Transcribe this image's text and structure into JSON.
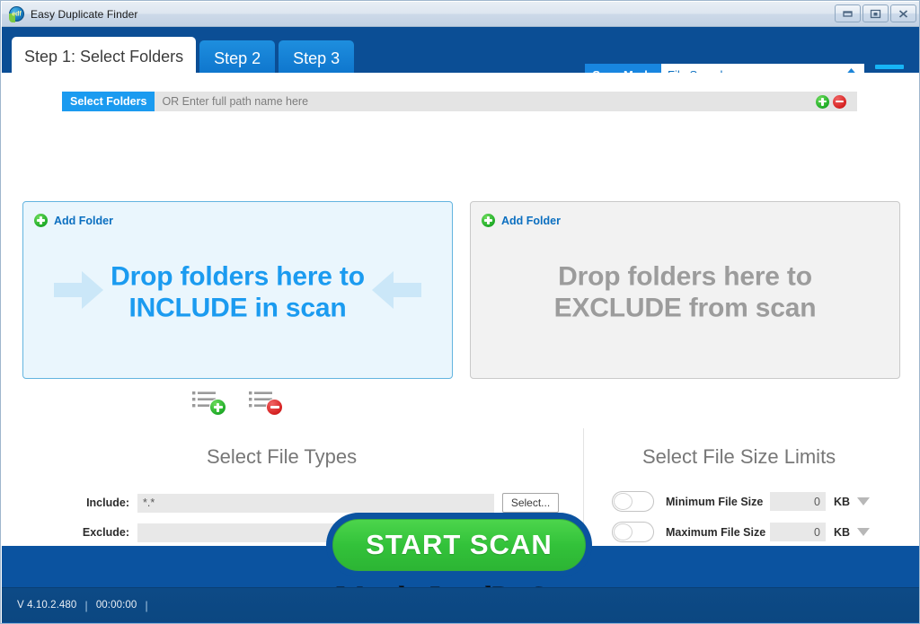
{
  "window": {
    "title": "Easy Duplicate Finder",
    "app_icon": "edf-logo-icon",
    "controls": {
      "minimize": "minimize-icon",
      "restore": "restore-icon",
      "close": "close-icon"
    }
  },
  "tabs": [
    {
      "label": "Step 1: Select Folders",
      "active": true
    },
    {
      "label": "Step 2",
      "active": false
    },
    {
      "label": "Step 3",
      "active": false
    }
  ],
  "scan_mode": {
    "label": "Scan Mode",
    "value": "File Search",
    "options": [
      "File Search"
    ]
  },
  "menu": {
    "icon": "hamburger-menu-icon"
  },
  "path_bar": {
    "button_label": "Select Folders",
    "placeholder": "OR Enter full path name here",
    "value": "",
    "add_icon": "add-circle-icon",
    "remove_icon": "remove-circle-icon"
  },
  "dropzones": {
    "include": {
      "add_folder_label": "Add Folder",
      "line1": "Drop folders here to",
      "line2": "INCLUDE in scan",
      "color": "#1b9bf0"
    },
    "exclude": {
      "add_folder_label": "Add Folder",
      "line1": "Drop folders here to",
      "line2": "EXCLUDE from scan",
      "color": "#9c9c9c"
    }
  },
  "list_actions": {
    "add": "add-list-item-icon",
    "remove": "remove-list-item-icon"
  },
  "file_types": {
    "title": "Select File Types",
    "include_label": "Include:",
    "include_value": "*.*",
    "exclude_label": "Exclude:",
    "exclude_value": "",
    "select_button": "Select..."
  },
  "file_size_limits": {
    "title": "Select File Size Limits",
    "minimum": {
      "label": "Minimum File Size",
      "value": "0",
      "unit": "KB",
      "enabled": false
    },
    "maximum": {
      "label": "Maximum File Size",
      "value": "0",
      "unit": "KB",
      "enabled": false
    }
  },
  "start_scan": {
    "label": "START  SCAN"
  },
  "status": {
    "version": "V 4.10.2.480",
    "separator": "|",
    "timer": "00:00:00",
    "separator2": "|"
  },
  "watermark": {
    "text": "WonderLandPc.Com"
  },
  "colors": {
    "header_blue": "#0b4e95",
    "accent_blue": "#1b9bf0",
    "footer_blue": "#0b53a0",
    "scan_green": "#33c23a"
  }
}
